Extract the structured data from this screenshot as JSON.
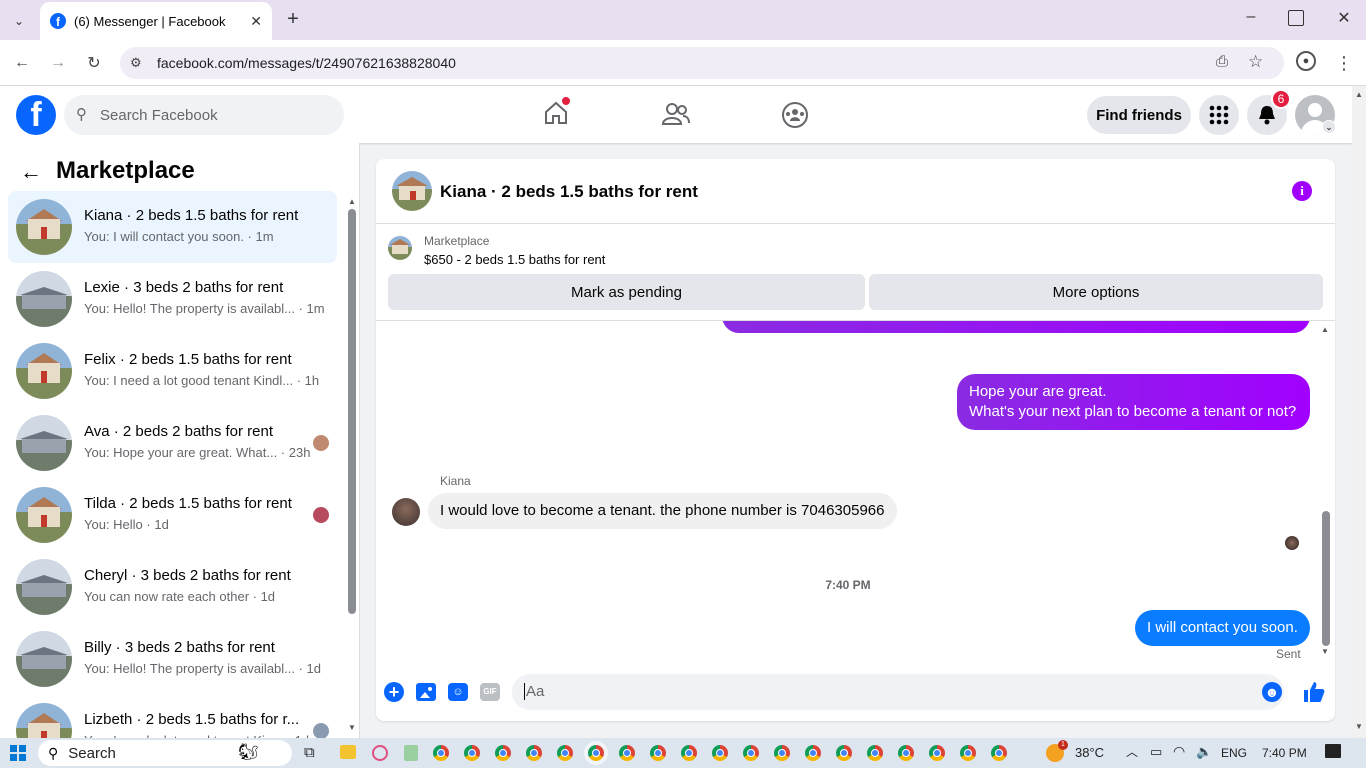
{
  "browser": {
    "tab_title": "(6) Messenger | Facebook",
    "url": "facebook.com/messages/t/24907621638828040"
  },
  "fb_header": {
    "search_placeholder": "Search Facebook",
    "find_friends": "Find friends",
    "notification_count": "6"
  },
  "sidebar": {
    "title": "Marketplace",
    "items": [
      {
        "title": "Kiana · 2 beds 1.5 baths for rent",
        "preview": "You: I will contact you soon. · 1m",
        "thumb": "house"
      },
      {
        "title": "Lexie · 3 beds 2 baths for rent",
        "preview": "You: Hello! The property is availabl... · 1m",
        "thumb": "grey"
      },
      {
        "title": "Felix · 2 beds 1.5 baths for rent",
        "preview": "You: I need a lot good tenant Kindl... · 1h",
        "thumb": "house"
      },
      {
        "title": "Ava · 2 beds 2 baths for rent",
        "preview": "You: Hope your are great. What... · 23h",
        "thumb": "grey"
      },
      {
        "title": "Tilda · 2 beds 1.5 baths for rent",
        "preview": "You: Hello · 1d",
        "thumb": "house"
      },
      {
        "title": "Cheryl · 3 beds 2 baths for rent",
        "preview": "You can now rate each other · 1d",
        "thumb": "grey"
      },
      {
        "title": "Billy · 3 beds 2 baths for rent",
        "preview": "You: Hello! The property is availabl... · 1d",
        "thumb": "grey"
      },
      {
        "title": "Lizbeth · 2 beds 1.5 baths for r...",
        "preview": "You: I need a lot good tenant Kin... · 1d",
        "thumb": "house"
      }
    ]
  },
  "chat": {
    "title": "Kiana · 2 beds 1.5 baths for rent",
    "listing_source": "Marketplace",
    "listing": "$650 - 2 beds 1.5 baths for rent",
    "mark_pending": "Mark as pending",
    "more_options": "More options",
    "msg_out_1_line1": "Hope your are great.",
    "msg_out_1_line2": "What's your next plan to become a tenant or not?",
    "sender_name": "Kiana",
    "msg_in_1": "I would love to become a tenant. the phone number is 7046305966",
    "timestamp": "7:40 PM",
    "msg_out_2": "I will contact you soon.",
    "status": "Sent",
    "composer_placeholder": "Aa"
  },
  "taskbar": {
    "search": "Search",
    "temperature": "38°C",
    "language": "ENG",
    "time": "7:40 PM",
    "weather_badge": "1"
  },
  "colors": {
    "fb_blue": "#0866ff",
    "messenger_purple": "#a100ff",
    "notification_red": "#e41e3f"
  }
}
